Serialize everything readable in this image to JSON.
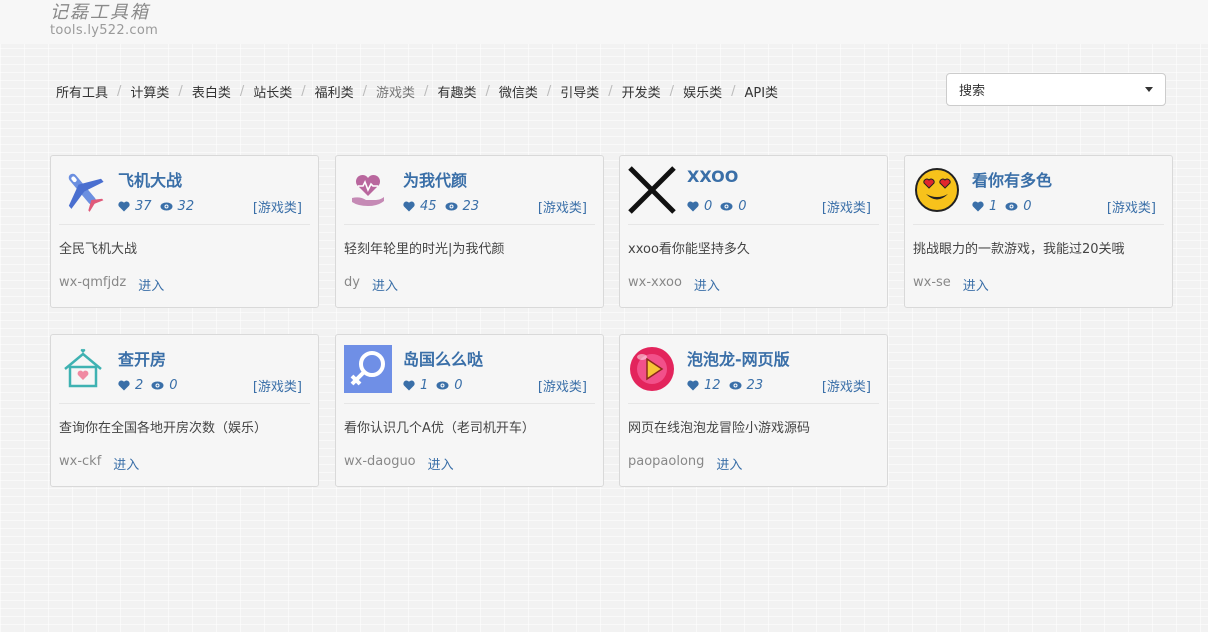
{
  "header": {
    "logo_cn": "记磊工具箱",
    "logo_en": "tools.ly522.com"
  },
  "nav": {
    "items": [
      "所有工具",
      "计算类",
      "表白类",
      "站长类",
      "福利类",
      "游戏类",
      "有趣类",
      "微信类",
      "引导类",
      "开发类",
      "娱乐类",
      "API类"
    ],
    "active": "游戏类"
  },
  "search": {
    "selected": "搜索"
  },
  "colors": {
    "accent": "#3a6fa8",
    "card_bg": "#f6f6f6",
    "border": "#d9d9d9"
  },
  "cards": [
    {
      "title": "飞机大战",
      "likes": "37",
      "views": "32",
      "category": "[游戏类]",
      "desc": "全民飞机大战",
      "code": "wx-qmfjdz",
      "enter": "进入",
      "icon": "airplane-icon"
    },
    {
      "title": "为我代颜",
      "likes": "45",
      "views": "23",
      "category": "[游戏类]",
      "desc": "轻刻年轮里的时光|为我代颜",
      "code": "dy",
      "enter": "进入",
      "icon": "heart-hand-icon"
    },
    {
      "title": "XXOO",
      "likes": "0",
      "views": "0",
      "category": "[游戏类]",
      "desc": "xxoo看你能坚持多久",
      "code": "wx-xxoo",
      "enter": "进入",
      "icon": "x-mark-icon"
    },
    {
      "title": "看你有多色",
      "likes": "1",
      "views": "0",
      "category": "[游戏类]",
      "desc": "挑战眼力的一款游戏，我能过20关哦",
      "code": "wx-se",
      "enter": "进入",
      "icon": "heart-eyes-emoji-icon"
    },
    {
      "title": "查开房",
      "likes": "2",
      "views": "0",
      "category": "[游戏类]",
      "desc": "查询你在全国各地开房次数（娱乐）",
      "code": "wx-ckf",
      "enter": "进入",
      "icon": "house-heart-icon"
    },
    {
      "title": "岛国么么哒",
      "likes": "1",
      "views": "0",
      "category": "[游戏类]",
      "desc": "看你认识几个A优（老司机开车）",
      "code": "wx-daoguo",
      "enter": "进入",
      "icon": "female-symbol-icon"
    },
    {
      "title": "泡泡龙-网页版",
      "likes": "12",
      "views": "23",
      "category": "[游戏类]",
      "desc": "网页在线泡泡龙冒险小游戏源码",
      "code": "paopaolong",
      "enter": "进入",
      "icon": "play-button-icon"
    }
  ]
}
